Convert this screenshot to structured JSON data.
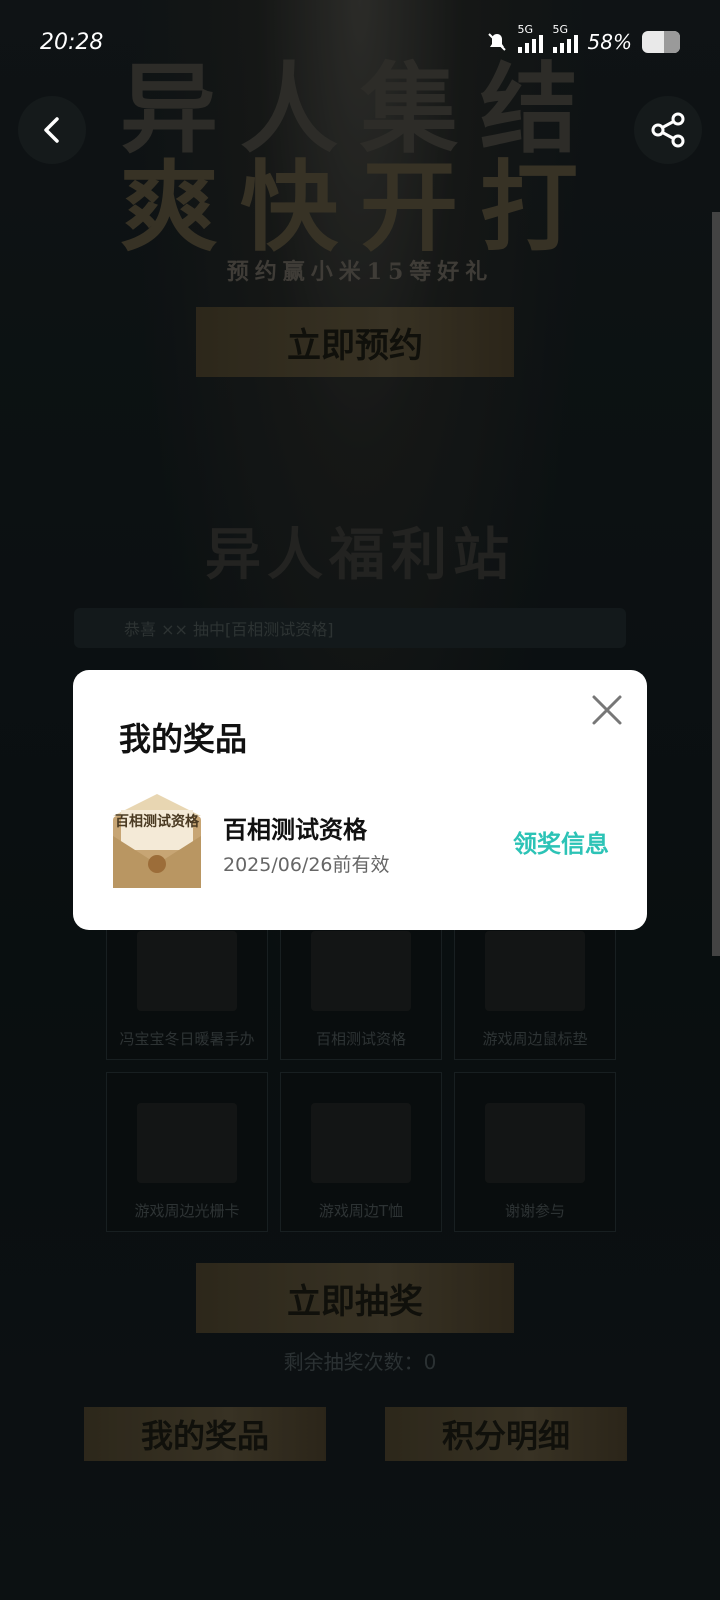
{
  "status_bar": {
    "time": "20:28",
    "network1": "5G",
    "network2": "5G",
    "battery": "58%"
  },
  "banner": {
    "line1": "异人集结",
    "line2": "爽快开打",
    "subtitle": "预约赢小米15等好礼",
    "reserve_label": "立即预约"
  },
  "welfare": {
    "title": "异人福利站",
    "ticker_text": "恭喜 ×× 抽中[百相测试资格]"
  },
  "prize_grid": [
    {
      "label": "冯宝宝冬日暖暑手办"
    },
    {
      "label": "百相测试资格"
    },
    {
      "label": "游戏周边鼠标垫"
    },
    {
      "label": "游戏周边光栅卡"
    },
    {
      "label": "游戏周边T恤"
    },
    {
      "label": "谢谢参与"
    }
  ],
  "actions": {
    "draw_label": "立即抽奖",
    "remaining_text": "剩余抽奖次数：0",
    "my_prizes_label": "我的奖品",
    "points_label": "积分明细"
  },
  "modal": {
    "title": "我的奖品",
    "items": [
      {
        "name": "百相测试资格",
        "valid_until": "2025/06/26前有效",
        "thumb_text": "百相测试资格",
        "claim_label": "领奖信息"
      }
    ]
  },
  "colors": {
    "accent": "#2cc3b6",
    "modal_bg": "#ffffff",
    "page_bg": "#0f1518"
  }
}
